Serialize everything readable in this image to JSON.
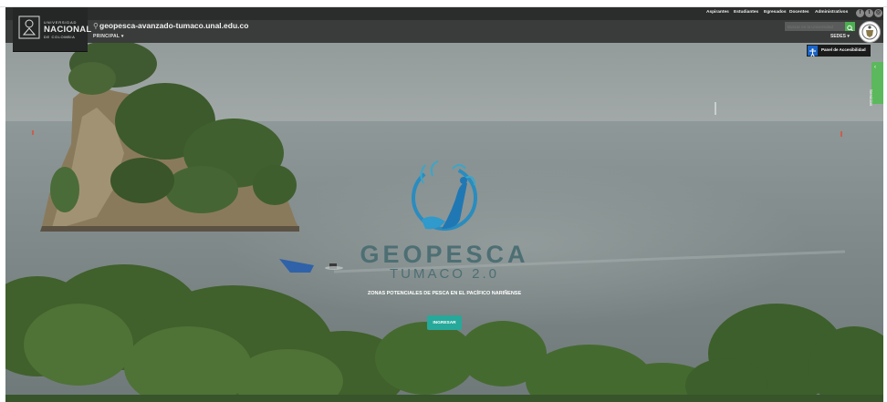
{
  "header": {
    "logo": {
      "line1": "UNIVERSIDAD",
      "line2": "NACIONAL",
      "line3": "DE COLOMBIA"
    },
    "site_url": "geopesca-avanzado-tumaco.unal.edu.co",
    "nav_principal": "PRINCIPAL",
    "top_links": [
      "Aspirantes",
      "Estudiantes",
      "Egresados",
      "Docentes",
      "Administrativos"
    ],
    "search_placeholder": "Buscar en la Universidad",
    "sedes": "SEDES",
    "accessibility_panel": "Panel de Accesibilidad",
    "services_tab": "Servicios"
  },
  "hero": {
    "title": "GEOPESCA",
    "subtitle": "TUMACO 2.0",
    "tagline": "ZONAS POTENCIALES DE PESCA EN EL PACÍFICO NARIÑENSE",
    "start_button": "INGRESAR"
  },
  "colors": {
    "header_bg": "#3a3b3b",
    "topbar_bg": "#2b2c2c",
    "accent_green": "#5cb85c",
    "button_teal": "#26a89a",
    "logo_blue": "#1f78b4",
    "title_color": "#4d6f74"
  },
  "icons": [
    "location-pin-icon",
    "search-icon",
    "chevron-down-icon",
    "accessibility-icon",
    "chevron-left-icon",
    "facebook-icon",
    "twitter-icon",
    "instagram-icon",
    "colombia-crest-icon"
  ]
}
